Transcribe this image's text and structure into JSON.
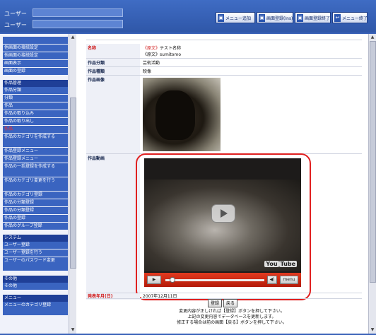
{
  "header": {
    "labels": [
      "ユーザー",
      "ユーザー"
    ],
    "fields": [
      "",
      ""
    ],
    "buttons": [
      {
        "label": "メニュー追加",
        "icon": "menu-add-icon"
      },
      {
        "label": "画面登録(Ins)",
        "icon": "register-icon"
      },
      {
        "label": "画面登録終了",
        "icon": "register-end-icon"
      },
      {
        "label": "メニュー終了",
        "icon": "menu-exit-icon"
      }
    ]
  },
  "sidebar": {
    "items": [
      {
        "label": "",
        "type": "item"
      },
      {
        "label": "他画面の接続設定",
        "type": "item"
      },
      {
        "label": "他画面の接続設定",
        "type": "item"
      },
      {
        "label": "画面表示",
        "type": "item"
      },
      {
        "label": "画面の登録",
        "type": "item"
      },
      {
        "label": "作品管理",
        "type": "header"
      },
      {
        "label": "作品分類",
        "type": "item"
      },
      {
        "label": "分類",
        "type": "item"
      },
      {
        "label": "作品",
        "type": "item"
      },
      {
        "label": "作品の取り込み",
        "type": "item"
      },
      {
        "label": "作品の取り出し",
        "type": "item"
      },
      {
        "label": "作品",
        "type": "item",
        "selected": true
      },
      {
        "label": "作品のカテゴリを作成する",
        "type": "item2"
      },
      {
        "label": "作品登録メニュー",
        "type": "item"
      },
      {
        "label": "作品登録メニュー",
        "type": "item"
      },
      {
        "label": "作品の一括登録を作成する",
        "type": "item2"
      },
      {
        "label": "作品のカテゴリ変更を行う",
        "type": "item2"
      },
      {
        "label": "作品のカテゴリ登録",
        "type": "item"
      },
      {
        "label": "作品の分類登録",
        "type": "item"
      },
      {
        "label": "作品の分類登録",
        "type": "item"
      },
      {
        "label": "作品の登録",
        "type": "item"
      },
      {
        "label": "作品のグループ登録",
        "type": "item"
      },
      {
        "label": "システム",
        "type": "header"
      },
      {
        "label": "ユーザー登録",
        "type": "item"
      },
      {
        "label": "ユーザー登録を行う",
        "type": "item"
      },
      {
        "label": "ユーザーのパスワード変更",
        "type": "item2"
      },
      {
        "label": "その他",
        "type": "header"
      },
      {
        "label": "その他",
        "type": "item"
      },
      {
        "label": "メニュー",
        "type": "header"
      },
      {
        "label": "メニューのカテゴリ登録",
        "type": "item2"
      }
    ]
  },
  "main": {
    "top_label": "",
    "rows": {
      "name": {
        "label": "名称",
        "value_red": "《原文》",
        "value": "テスト名称",
        "value2_red": "《原文》",
        "value2": "sumitomo"
      },
      "category": {
        "label": "作品分類",
        "value": "芸術活動"
      },
      "type": {
        "label": "作品種類",
        "value": "映像"
      },
      "image": {
        "label": "作品画像"
      },
      "video": {
        "label": "作品動画"
      },
      "date": {
        "label": "発表年月(日)",
        "value": "2007年12月11日"
      }
    },
    "video_player": {
      "logo": "You",
      "logo_box": "Tube",
      "menu_label": "menu",
      "progress_fraction": 0.04
    },
    "buttons": {
      "register": "登録",
      "back": "戻る"
    },
    "notes": [
      "変更内容が正しければ【登録】ボタンを押して下さい。",
      "上記の変更内容でデータベースを更新します。",
      "修正する場合は前の画面【戻る】ボタンを押して下さい。"
    ]
  }
}
